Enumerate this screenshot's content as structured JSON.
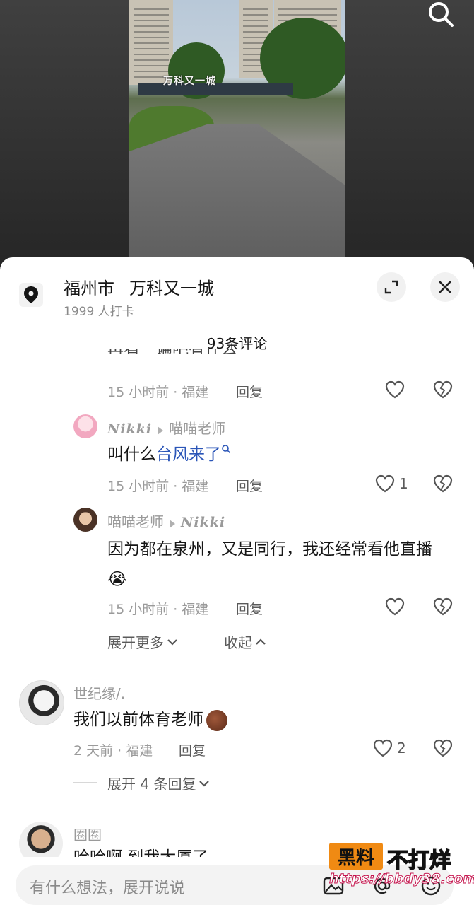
{
  "location": {
    "city": "福州市",
    "name": "万科又一城",
    "checkins": "1999 人打卡"
  },
  "video": {
    "sign_text": "万科又一城"
  },
  "comments_title": "93条评论",
  "comments": [
    {
      "partial_text": "再看一遍吧有什么",
      "meta": "15 小时前 · 福建",
      "reply": "回复"
    },
    {
      "user": "Nikki",
      "reply_to": "喵喵老师",
      "text_prefix": "叫什么",
      "link": "台风来了",
      "meta": "15 小时前 · 福建",
      "reply": "回复",
      "likes": "1"
    },
    {
      "user": "喵喵老师",
      "reply_to": "Nikki",
      "text": "因为都在泉州，又是同行，我还经常看他直播",
      "emoji": "😭",
      "meta": "15 小时前 · 福建",
      "reply": "回复"
    }
  ],
  "expand_more": "展开更多",
  "collapse": "收起",
  "comment2": {
    "user": "世纪缘/.",
    "text": "我们以前体育老师",
    "meta": "2 天前 · 福建",
    "reply": "回复",
    "likes": "2",
    "expand": "展开 4 条回复"
  },
  "comment3": {
    "user": "圈圈",
    "text": "哈哈啊 到我大厦了"
  },
  "input": {
    "placeholder": "有什么想法，展开说说"
  },
  "watermark": {
    "box": "黑料",
    "text": "不打烊",
    "url": "https://bbdy38.com"
  },
  "colors": {
    "link": "#2b56b8",
    "watermark_orange": "#f08a13"
  }
}
